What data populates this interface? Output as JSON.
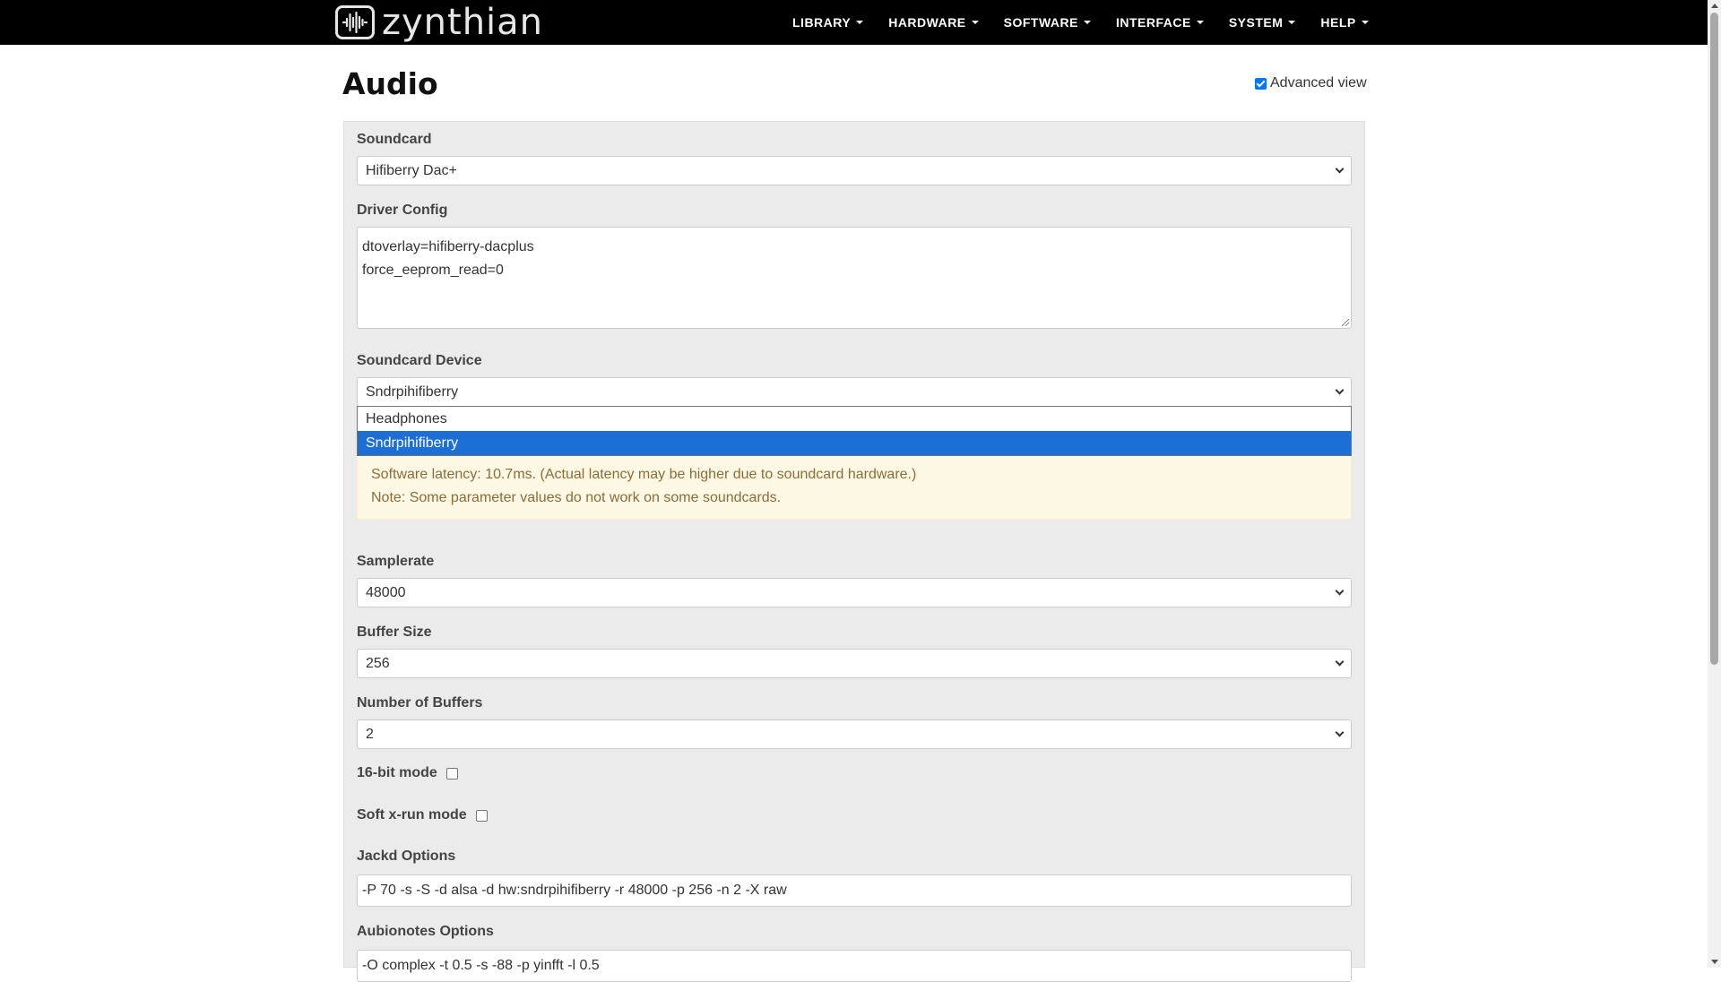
{
  "brand": {
    "name": "zynthian"
  },
  "nav": {
    "items": [
      {
        "label": "LIBRARY"
      },
      {
        "label": "HARDWARE"
      },
      {
        "label": "SOFTWARE"
      },
      {
        "label": "INTERFACE"
      },
      {
        "label": "SYSTEM"
      },
      {
        "label": "HELP"
      }
    ]
  },
  "page": {
    "title": "Audio",
    "advanced_view_label": "Advanced view",
    "advanced_view_checked": true
  },
  "form": {
    "soundcard": {
      "label": "Soundcard",
      "value": "Hifiberry Dac+"
    },
    "driver_config": {
      "label": "Driver Config",
      "lines": [
        "dtoverlay=hifiberry-dacplus",
        "force_eeprom_read=0"
      ]
    },
    "soundcard_device": {
      "label": "Soundcard Device",
      "value": "Sndrpihifiberry",
      "options": [
        {
          "label": "Headphones",
          "selected": false
        },
        {
          "label": "Sndrpihifiberry",
          "selected": true
        }
      ]
    },
    "alert": {
      "line1": "Software latency: 10.7ms. (Actual latency may be higher due to soundcard hardware.)",
      "line2": "Note: Some parameter values do not work on some soundcards."
    },
    "samplerate": {
      "label": "Samplerate",
      "value": "48000"
    },
    "buffer_size": {
      "label": "Buffer Size",
      "value": "256"
    },
    "number_of_buffers": {
      "label": "Number of Buffers",
      "value": "2"
    },
    "mode_16bit": {
      "label": "16-bit mode",
      "checked": false
    },
    "soft_xrun": {
      "label": "Soft x-run mode",
      "checked": false
    },
    "jackd_options": {
      "label": "Jackd Options",
      "value": "-P 70 -s -S -d alsa -d hw:sndrpihifiberry -r 48000 -p 256 -n 2 -X raw"
    },
    "aubionotes_options": {
      "label": "Aubionotes Options",
      "value": "-O complex -t 0.5 -s -88 -p yinfft -l 0.5"
    }
  },
  "colors": {
    "navbar_bg": "#000000",
    "panel_bg": "#ebebeb",
    "selected_option": "#1c6fd6",
    "alert_bg": "#fcf8e3",
    "alert_text": "#8a6d3b",
    "checkbox_accent": "#0075ff"
  },
  "icons": {
    "logo": "waveform-logo-icon",
    "nav_caret": "caret-down-icon",
    "select_chevron": "chevron-down-icon"
  }
}
